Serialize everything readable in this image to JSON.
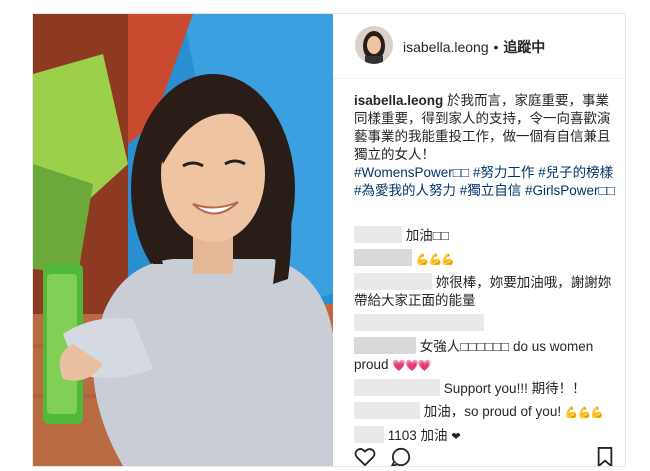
{
  "header": {
    "username": "isabella.leong",
    "separator": "•",
    "follow_status": "追蹤中"
  },
  "caption": {
    "username": "isabella.leong",
    "text": "於我而言，家庭重要，事業同樣重要，得到家人的支持，令一向喜歡演藝事業的我能重投工作，做一個有自信兼且獨立的女人！",
    "hashtags": "#WomensPower□□ #努力工作 #兒子的榜樣 #為愛我的人努力 #獨立自信 #GirlsPower□□"
  },
  "comments": [
    {
      "text": "加油□□",
      "emoji": ""
    },
    {
      "text": "",
      "emoji": "💪💪💪"
    },
    {
      "text": "妳很棒，妳要加油哦，謝謝妳帶給大家正面的能量",
      "emoji": ""
    },
    {
      "text": "",
      "emoji": ""
    },
    {
      "text": "女強人□□□□□□ do us women proud",
      "emoji": "💗💗💗"
    },
    {
      "text": "Support you!!! 期待！！",
      "emoji": ""
    },
    {
      "text": "加油，so proud of you!",
      "emoji": "💪💪💪"
    },
    {
      "text": "1103 加油",
      "emoji": "❤"
    }
  ],
  "icons": {
    "like": "heart-outline-icon",
    "comment": "comment-bubble-icon",
    "save": "bookmark-icon"
  },
  "colors": {
    "hashtag": "#003569",
    "text": "#262626"
  }
}
